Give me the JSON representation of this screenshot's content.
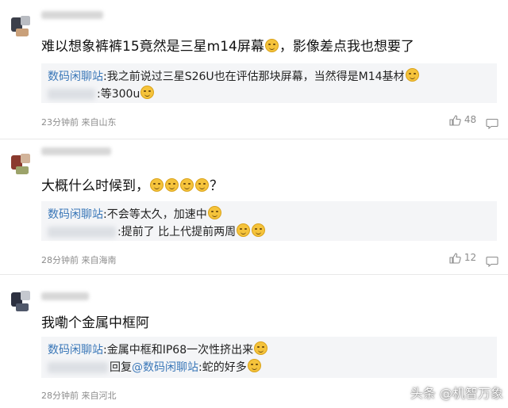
{
  "comments": [
    {
      "text": "难以想象裤裤15竟然是三星m14屏幕",
      "text_after_emoji": "，影像差点我也想要了",
      "replies": [
        {
          "name": "数码闲聊站",
          "text": ":我之前说过三星S26U也在评估那块屏幕，当然得是M14基材"
        },
        {
          "name": "",
          "text": ":等300u"
        }
      ],
      "meta": "23分钟前 来自山东",
      "likes": "48"
    },
    {
      "text": "大概什么时候到，",
      "text_after_emoji": "？",
      "replies": [
        {
          "name": "数码闲聊站",
          "text": ":不会等太久，加速中"
        },
        {
          "name": "",
          "text": ":提前了 比上代提前两周"
        }
      ],
      "meta": "28分钟前 来自海南",
      "likes": "12"
    },
    {
      "text": "我嘞个金属中框阿",
      "replies": [
        {
          "name": "数码闲聊站",
          "text": ":金属中框和IP68一次性挤出来"
        },
        {
          "name": "",
          "prefix": "回复",
          "mention": "@数码闲聊站",
          "text": ":蛇的好多"
        }
      ],
      "meta": "28分钟前 来自河北"
    }
  ],
  "watermark": "头条 @机智万象",
  "colors": {
    "link": "#3a77b8",
    "meta": "#8c8c8c",
    "reply_bg": "#f4f5f7",
    "emoji": "#f5c33b"
  },
  "icons": [
    "thumbs-up-icon",
    "comment-icon",
    "emoji-icon"
  ]
}
